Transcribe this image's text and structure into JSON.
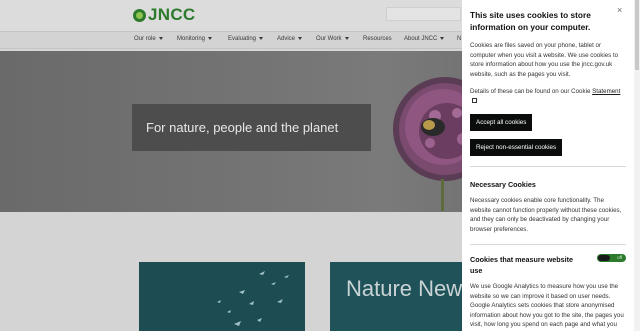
{
  "header": {
    "logo_text": "JNCC"
  },
  "nav": {
    "items": [
      {
        "label": "Our role",
        "has_caret": true
      },
      {
        "label": "Monitoring",
        "has_caret": true
      },
      {
        "label": "Evaluating",
        "has_caret": true
      },
      {
        "label": "Advice",
        "has_caret": true
      },
      {
        "label": "Our Work",
        "has_caret": true
      },
      {
        "label": "Resources",
        "has_caret": false
      },
      {
        "label": "About JNCC",
        "has_caret": true
      },
      {
        "label": "N",
        "has_caret": false
      }
    ]
  },
  "hero": {
    "tagline": "For nature, people and the planet"
  },
  "cards": {
    "card2_title": "Nature New"
  },
  "cookie_panel": {
    "title": "This site uses cookies to store information on your computer.",
    "intro": "Cookies are files saved on your phone, tablet or computer when you visit a website. We use cookies to store information about how you use the jncc.gov.uk website, such as the pages you visit.",
    "details_prefix": "Details of these can be found on our Cookie",
    "details_link": "Statement",
    "accept_button": "Accept all cookies",
    "reject_button": "Reject non-essential cookies",
    "necessary_heading": "Necessary Cookies",
    "necessary_text": "Necessary cookies enable core functionality. The website cannot function properly without these cookies, and they can only be deactivated by changing your browser preferences.",
    "measure_heading": "Cookies that measure website use",
    "toggle_label": "off",
    "measure_text": "We use Google Analytics to measure how you use the website so we can improve it based on user needs. Google Analytics sets cookies that store anonymised information about how you got to the site, the pages you visit, how long you spend on each page and what you click on while you are visiting the site.",
    "close_symbol": "×"
  },
  "colors": {
    "brand_green": "#2d7a2d",
    "button_black": "#0b0c0c"
  }
}
